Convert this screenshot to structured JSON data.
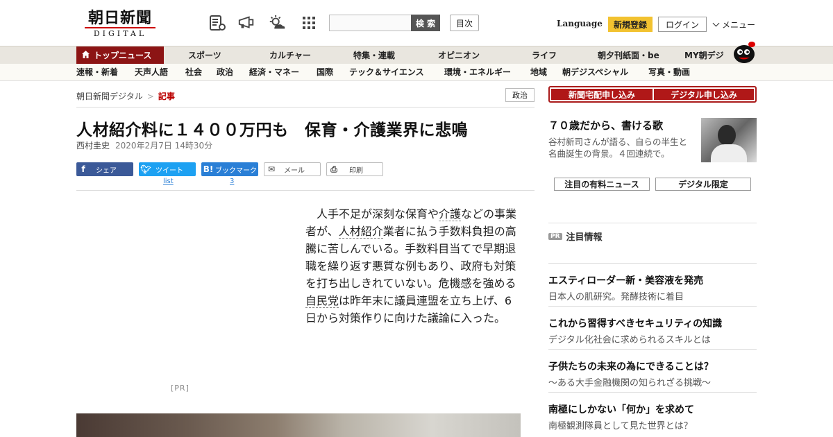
{
  "header": {
    "logo_kanji": "朝日新聞",
    "logo_sub": "DIGITAL",
    "search_button": "検 索",
    "index_button": "目次",
    "language": "Language",
    "register": "新規登録",
    "login": "ログイン",
    "menu": "メニュー"
  },
  "nav_main": [
    "トップニュース",
    "スポーツ",
    "カルチャー",
    "特集・連載",
    "オピニオン",
    "ライフ",
    "朝夕刊紙面・be",
    "MY朝デジ"
  ],
  "nav_sub": [
    "速報・新着",
    "天声人語",
    "社会",
    "政治",
    "経済・マネー",
    "国際",
    "テック＆サイエンス",
    "環境・エネルギー",
    "地域",
    "朝デジスペシャル",
    "写真・動画"
  ],
  "breadcrumb": {
    "home": "朝日新聞デジタル",
    "sep": ">",
    "current": "記事"
  },
  "category_tag": "政治",
  "article": {
    "title": "人材紹介料に１４００万円も　保育・介護業界に悲鳴",
    "author": "西村圭史",
    "date": "2020年2月7日 14時30分",
    "body_parts": [
      "人手不足が深刻な保育や",
      "介護",
      "などの事業者が、",
      "人材紹介",
      "業者に払う手数料負担の高騰に苦しんでいる。手数料目当てで早期退職を繰り返す悪質な例もあり、政府も対策を打ち出しきれていない。危機感を強める",
      "自民党",
      "は昨年末に議員連盟を立ち上げ、6日から対策作りに向けた議論に入った。"
    ],
    "pr_label": "[PR]"
  },
  "share": {
    "facebook": "シェア",
    "twitter": "ツイート",
    "twitter_count": "list",
    "hatena": "ブックマーク",
    "hatena_count": "3",
    "mail": "メール",
    "print": "印刷"
  },
  "sidebar": {
    "subscribe_paper": "新聞宅配申し込み",
    "subscribe_digital": "デジタル申し込み",
    "feature_title": "７０歳だから、書ける歌",
    "feature_text": "谷村新司さんが語る、自らの半生と名曲誕生の背景。４回連続で。",
    "tab_paid": "注目の有料ニュース",
    "tab_digital": "デジタル限定",
    "pr_tag": "PR",
    "pr_heading": "注目情報",
    "ads": [
      {
        "title": "エスティローダー新・美容液を発売",
        "sub": "日本人の肌研究。発酵技術に着目"
      },
      {
        "title": "これから習得すべきセキュリティの知識",
        "sub": "デジタル化社会に求められるスキルとは"
      },
      {
        "title": "子供たちの未来の為にできることは？",
        "sub": "～ある大手金融機関の知られざる挑戦～"
      },
      {
        "title": "南極にしかない「何か」を求めて",
        "sub": "南極観測隊員として見た世界とは？"
      }
    ]
  },
  "colors": {
    "brand_red": "#b01818",
    "nav_active": "#8c1414",
    "register_yellow": "#f2c230",
    "facebook": "#3b5998",
    "twitter": "#1da1f2",
    "hatena": "#2a7fd6"
  }
}
